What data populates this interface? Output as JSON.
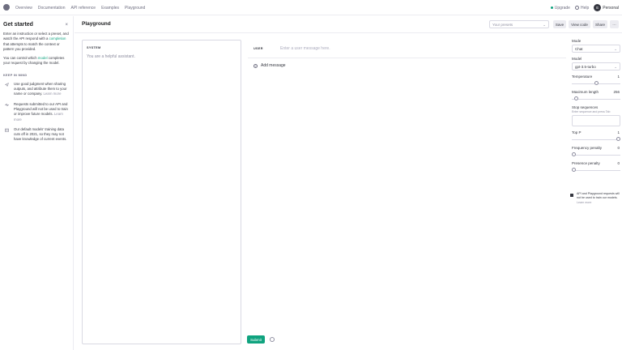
{
  "topbar": {
    "nav": [
      "Overview",
      "Documentation",
      "API reference",
      "Examples",
      "Playground"
    ],
    "upgrade": "Upgrade",
    "help": "Help",
    "avatar_letter": "E",
    "account": "Personal"
  },
  "left_panel": {
    "title": "Get started",
    "close": "×",
    "intro_pre": "Enter an instruction or select a preset, and watch the API respond with a",
    "intro_link": "completion",
    "intro_post": "that attempts to match the context or pattern you provided.",
    "model_pre": "You can control which",
    "model_link": "model",
    "model_post": "completes your request by changing the model.",
    "keep_heading": "KEEP IN MIND",
    "tips": [
      {
        "icon": "send-icon",
        "text": "Use good judgment when sharing outputs, and attribute them to your name or company.",
        "link": "Learn more"
      },
      {
        "icon": "pulse-icon",
        "text": "Requests submitted to our API and Playground will not be used to train or improve future models.",
        "link": "Learn more"
      },
      {
        "icon": "calendar-icon",
        "text": "Our default models' training data cuts off in 2021, so they may not have knowledge of current events.",
        "link": ""
      }
    ]
  },
  "main": {
    "title": "Playground",
    "preset_placeholder": "Your presets",
    "buttons": {
      "save": "Save",
      "view_code": "View code",
      "share": "Share",
      "more": "···"
    },
    "system_label": "SYSTEM",
    "system_text": "You are a helpful assistant.",
    "user_label": "USER",
    "user_placeholder": "Enter a user message here.",
    "add_message": "Add message",
    "submit": "Submit"
  },
  "settings": {
    "mode_label": "Mode",
    "mode_value": "Chat",
    "model_label": "Model",
    "model_value": "gpt-3.5-turbo",
    "temperature_label": "Temperature",
    "temperature_value": "1",
    "temperature_fraction": 0.5,
    "max_length_label": "Maximum length",
    "max_length_value": "256",
    "max_length_fraction": 0.06,
    "stop_label": "Stop sequences",
    "stop_hint": "Enter sequence and press Tab",
    "top_p_label": "Top P",
    "top_p_value": "1",
    "top_p_fraction": 1.0,
    "freq_label": "Frequency penalty",
    "freq_value": "0",
    "freq_fraction": 0.0,
    "presence_label": "Presence penalty",
    "presence_value": "0",
    "presence_fraction": 0.0,
    "privacy_pre": "API and Playground requests will not be used to train our models.",
    "privacy_link": "Learn more"
  }
}
